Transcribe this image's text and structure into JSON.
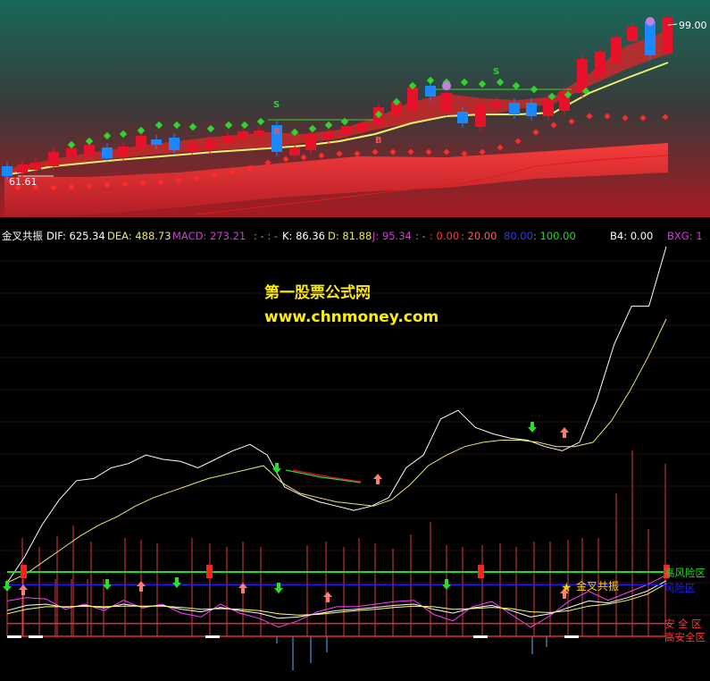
{
  "colors": {
    "bg": "#000000",
    "up": "#e8112a",
    "down": "#1a88ff",
    "dif": "#ffffff",
    "dea": "#e8e86a",
    "gridline": "#2a0f0f",
    "high_risk_line": "#29d72a",
    "risk_line": "#2222ee",
    "safe_line": "#e03030",
    "buy_arrow": "#ff7b6b",
    "sell_arrow": "#2edc2e"
  },
  "price_panel": {
    "price_high_label": "99.00",
    "price_low_label": "61.61",
    "signal_marks": [
      "S",
      "S",
      "B",
      "B"
    ]
  },
  "indicator_header": {
    "name": "金叉共振",
    "dif": "DIF: 625.34",
    "dea": "DEA: 488.73",
    "macd": "MACD: 273.21",
    "sep1": ": -  : -",
    "k": "K: 86.36",
    "d": "D: 81.88",
    "j": "J: 95.34",
    "sep2": ": -",
    "v1": ": 0.00",
    "v2": ": 20.00",
    "v3": "80.00",
    "v4": ": 100.00",
    "b4": "B4: 0.00",
    "bxg": "BXG: 1"
  },
  "watermark": {
    "line1": "第一股票公式网",
    "line2": "www.chnmoney.com"
  },
  "oscillator": {
    "zone_high_risk": "高风险区",
    "zone_risk": "风险区",
    "zone_safe": "安 全 区",
    "zone_high_safe": "高安全区",
    "golden_cross_label": "金叉共振"
  },
  "chart_data": {
    "type": "line",
    "title": "金叉共振",
    "series": [
      {
        "name": "DIF",
        "values": [
          0,
          60,
          135,
          195,
          240,
          245,
          270,
          280,
          300,
          290,
          285,
          270,
          290,
          310,
          325,
          300,
          225,
          205,
          190,
          180,
          170,
          180,
          200,
          270,
          300,
          385,
          405,
          365,
          350,
          340,
          335,
          320,
          310,
          330,
          430,
          560,
          650,
          650,
          790
        ]
      },
      {
        "name": "DEA",
        "values": [
          0,
          20,
          50,
          80,
          110,
          135,
          155,
          180,
          200,
          215,
          230,
          245,
          255,
          265,
          275,
          235,
          210,
          200,
          190,
          185,
          180,
          195,
          230,
          275,
          300,
          320,
          330,
          335,
          335,
          330,
          320,
          320,
          330,
          380,
          450,
          530,
          620
        ]
      },
      {
        "name": "K",
        "values": [
          40,
          48,
          50,
          45,
          48,
          44,
          50,
          46,
          48,
          42,
          38,
          45,
          40,
          36,
          28,
          30,
          35,
          40,
          42,
          45,
          48,
          50,
          42,
          36,
          44,
          48,
          40,
          30,
          35,
          45,
          55,
          52,
          60,
          70,
          86.36
        ]
      },
      {
        "name": "D",
        "values": [
          35,
          42,
          46,
          46,
          47,
          46,
          47,
          47,
          47,
          45,
          42,
          43,
          42,
          40,
          35,
          33,
          34,
          37,
          40,
          42,
          45,
          47,
          46,
          42,
          43,
          45,
          43,
          38,
          37,
          40,
          47,
          50,
          56,
          65,
          81.88
        ]
      },
      {
        "name": "J",
        "values": [
          55,
          60,
          58,
          42,
          50,
          40,
          56,
          44,
          50,
          36,
          30,
          50,
          36,
          28,
          14,
          24,
          38,
          46,
          46,
          50,
          54,
          56,
          34,
          24,
          46,
          54,
          34,
          14,
          32,
          55,
          70,
          56,
          68,
          80,
          95.34
        ]
      }
    ],
    "reference_levels": [
      {
        "label": "高风险区",
        "value": 100
      },
      {
        "label": "风险区",
        "value": 80
      },
      {
        "label": "安 全 区",
        "value": 20
      },
      {
        "label": "高安全区",
        "value": 0
      }
    ]
  }
}
